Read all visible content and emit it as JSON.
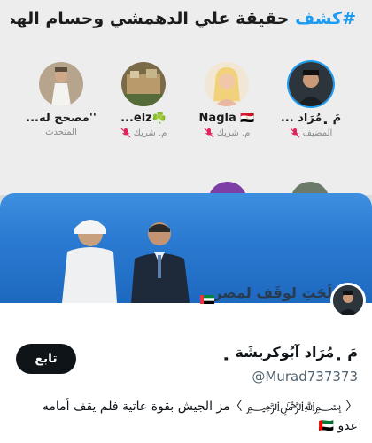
{
  "space": {
    "hashtag": "#كشف",
    "title_rest": " حقيقة علي الدهمشي وحسام الهطف"
  },
  "speakers": [
    {
      "name": "مَ ﮼مُرَاد ...",
      "role": "المضيف",
      "muted": true,
      "ring": true
    },
    {
      "name": "Nagla 🇪🇬",
      "role": "م. شريك",
      "muted": true,
      "ring": false
    },
    {
      "name": "☘️elz...",
      "role": "م. شريك",
      "muted": true,
      "ring": false
    },
    {
      "name": "''مصحح له...",
      "role": "المتحدث",
      "muted": false,
      "ring": false
    }
  ],
  "profile": {
    "banner_text": "لِمَصْلَحَتِ ﻟﻮﻗَﻒ ﻟﻤﺼﺮ",
    "display_name": "مَ ﮼مُرَاد آبُوكريشَة ﮼",
    "handle": "@Murad737373",
    "follow_label": "تابع",
    "bio_line1": "〈 ﷽ 〉مز الجيش بقوة عاتية فلم يقف أمامه",
    "bio_line2": "عدو 🇦🇪"
  },
  "colors": {
    "accent": "#1d9bf0",
    "follow_bg": "#0f1419",
    "muted_icon": "#e0245e"
  }
}
